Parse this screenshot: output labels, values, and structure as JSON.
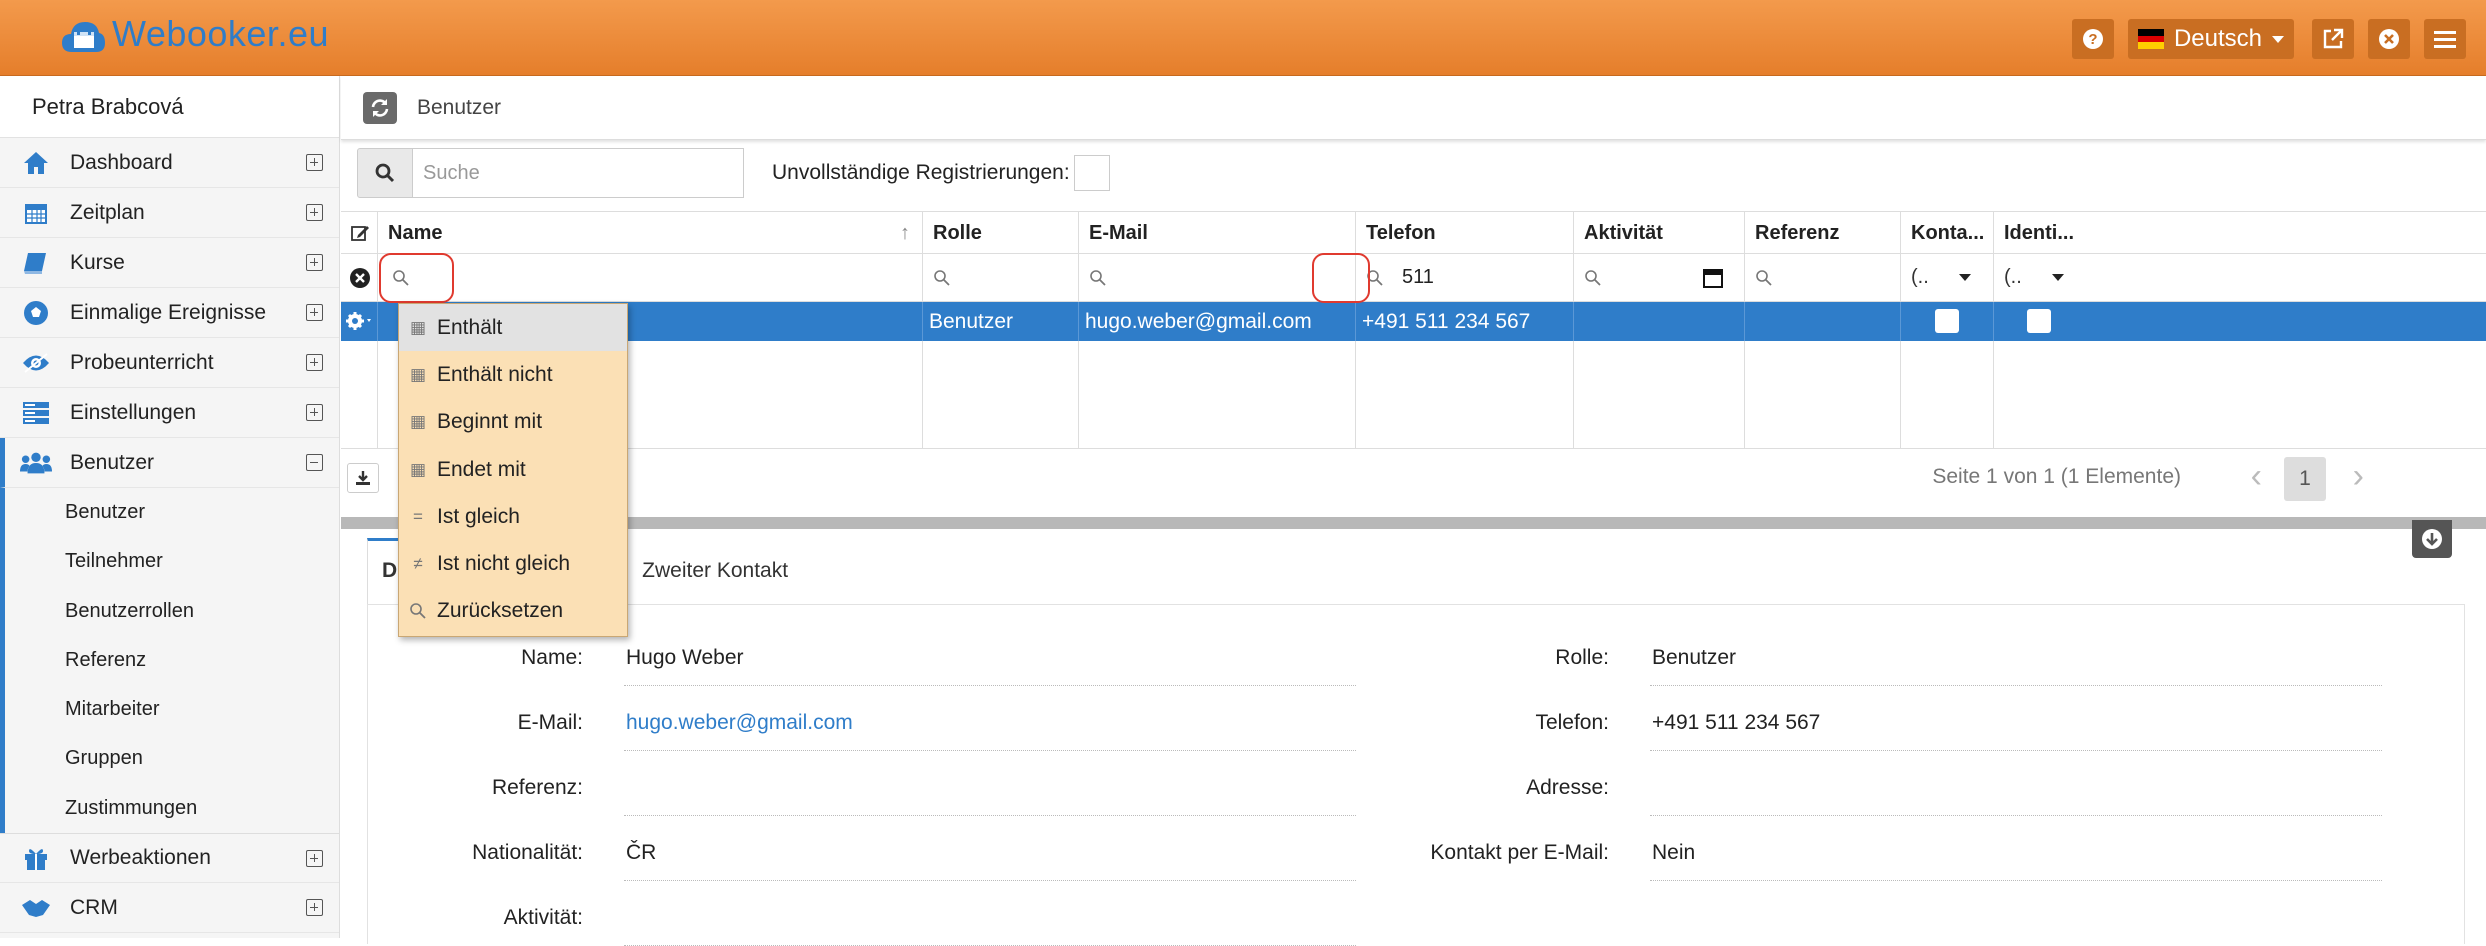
{
  "app": {
    "logo_text": "Webooker.eu",
    "accent": "#2f7dc9",
    "topbar_color": "#e98a38"
  },
  "topbar": {
    "language_label": "Deutsch",
    "help_icon": "question-circle-icon",
    "external_icon": "external-link-icon",
    "logout_icon": "close-circle-icon",
    "menu_icon": "hamburger-icon"
  },
  "sidebar": {
    "user_name": "Petra Brabcová",
    "items": [
      {
        "label": "Dashboard",
        "icon": "home-icon"
      },
      {
        "label": "Zeitplan",
        "icon": "calendar-icon"
      },
      {
        "label": "Kurse",
        "icon": "book-icon"
      },
      {
        "label": "Einmalige Ereignisse",
        "icon": "soccer-ball-icon"
      },
      {
        "label": "Probeunterricht",
        "icon": "eye-icon"
      },
      {
        "label": "Einstellungen",
        "icon": "server-icon"
      },
      {
        "label": "Benutzer",
        "icon": "users-icon"
      }
    ],
    "sub_items": [
      "Benutzer",
      "Teilnehmer",
      "Benutzerrollen",
      "Referenz",
      "Mitarbeiter",
      "Gruppen",
      "Zustimmungen"
    ],
    "items_after": [
      {
        "label": "Werbeaktionen",
        "icon": "gift-icon"
      },
      {
        "label": "CRM",
        "icon": "handshake-icon"
      }
    ]
  },
  "breadcrumb": {
    "title": "Benutzer"
  },
  "search": {
    "placeholder": "Suche",
    "incomplete_label": "Unvollständige Registrierungen:"
  },
  "grid": {
    "columns": [
      "Name",
      "Rolle",
      "E-Mail",
      "Telefon",
      "Aktivität",
      "Referenz",
      "Konta...",
      "Identi..."
    ],
    "filter_values": {
      "telefon": "511",
      "konta": "(..",
      "identi": "(.."
    },
    "rows": [
      {
        "name": "",
        "rolle": "Benutzer",
        "email": "hugo.weber@gmail.com",
        "telefon": "+491 511 234 567",
        "aktivitaet": "",
        "referenz": ""
      }
    ],
    "pager_text": "Seite 1 von 1 (1 Elemente)",
    "current_page": "1"
  },
  "filter_menu": {
    "items": [
      {
        "label": "Enthält",
        "icon": "abc"
      },
      {
        "label": "Enthält nicht",
        "icon": "abc"
      },
      {
        "label": "Beginnt mit",
        "icon": "abc"
      },
      {
        "label": "Endet mit",
        "icon": "abc"
      },
      {
        "label": "Ist gleich",
        "icon": "="
      },
      {
        "label": "Ist nicht gleich",
        "icon": "≠"
      },
      {
        "label": "Zurücksetzen",
        "icon": "search"
      }
    ]
  },
  "detail": {
    "tabs": [
      "D",
      "Zweiter Kontakt"
    ],
    "left": [
      {
        "label": "Name:",
        "value": "Hugo Weber"
      },
      {
        "label": "E-Mail:",
        "value": "hugo.weber@gmail.com"
      },
      {
        "label": "Referenz:",
        "value": ""
      },
      {
        "label": "Nationalität:",
        "value": "ČR"
      },
      {
        "label": "Aktivität:",
        "value": ""
      }
    ],
    "right": [
      {
        "label": "Rolle:",
        "value": "Benutzer"
      },
      {
        "label": "Telefon:",
        "value": "+491 511 234 567"
      },
      {
        "label": "Adresse:",
        "value": ""
      },
      {
        "label": "Kontakt per E-Mail:",
        "value": "Nein"
      }
    ]
  }
}
